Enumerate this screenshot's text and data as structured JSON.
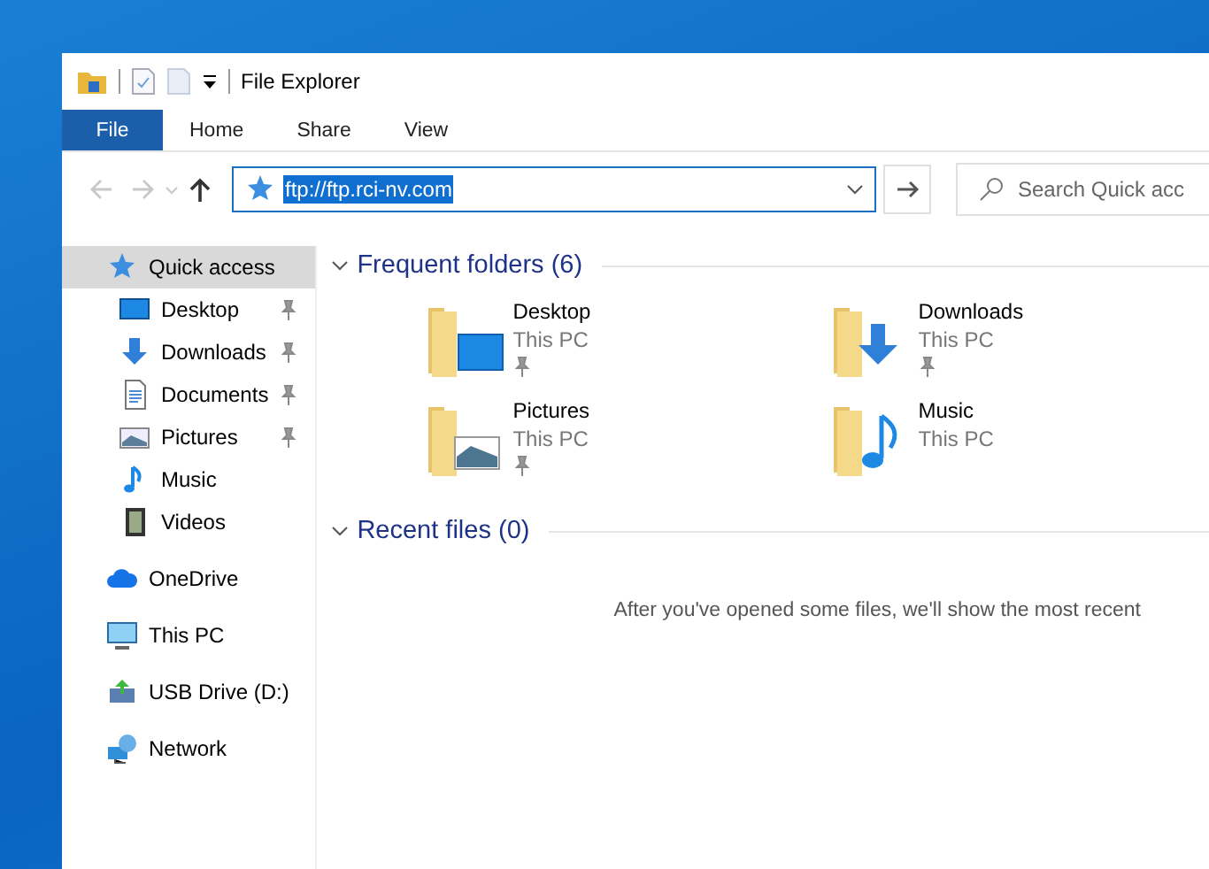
{
  "window": {
    "title": "File Explorer"
  },
  "ribbon_tabs": [
    {
      "label": "File",
      "selected": true
    },
    {
      "label": "Home",
      "selected": false
    },
    {
      "label": "Share",
      "selected": false
    },
    {
      "label": "View",
      "selected": false
    }
  ],
  "navigation": {
    "back_disabled": true,
    "forward_disabled": true
  },
  "address": {
    "value": "ftp://ftp.rci-nv.com",
    "selected": true
  },
  "search": {
    "placeholder": "Search Quick acc"
  },
  "sidebar": {
    "items": [
      {
        "label": "Quick access",
        "kind": "star",
        "selected": true,
        "children": [
          {
            "label": "Desktop",
            "kind": "desktop",
            "pinned": true,
            "selected": false
          },
          {
            "label": "Downloads",
            "kind": "downloads",
            "pinned": true,
            "selected": false
          },
          {
            "label": "Documents",
            "kind": "documents",
            "pinned": true,
            "selected": false
          },
          {
            "label": "Pictures",
            "kind": "pictures",
            "pinned": true,
            "selected": false
          },
          {
            "label": "Music",
            "kind": "music",
            "pinned": false,
            "selected": false
          },
          {
            "label": "Videos",
            "kind": "videos",
            "pinned": false,
            "selected": false
          }
        ]
      },
      {
        "label": "OneDrive",
        "kind": "cloud",
        "selected": false
      },
      {
        "label": "This PC",
        "kind": "pc",
        "selected": false
      },
      {
        "label": "USB Drive (D:)",
        "kind": "usb",
        "selected": false
      },
      {
        "label": "Network",
        "kind": "network",
        "selected": false
      }
    ]
  },
  "sections": [
    {
      "title": "Frequent folders (6)",
      "expanded": true,
      "folders": [
        {
          "name": "Desktop",
          "location": "This PC",
          "kind": "desktop",
          "pinned": true
        },
        {
          "name": "Downloads",
          "location": "This PC",
          "kind": "downloads",
          "pinned": true
        },
        {
          "name": "Pictures",
          "location": "This PC",
          "kind": "pictures",
          "pinned": true
        },
        {
          "name": "Music",
          "location": "This PC",
          "kind": "music",
          "pinned": false
        }
      ]
    },
    {
      "title": "Recent files (0)",
      "expanded": true,
      "message": "After you've opened some files, we'll show the most recent"
    }
  ]
}
